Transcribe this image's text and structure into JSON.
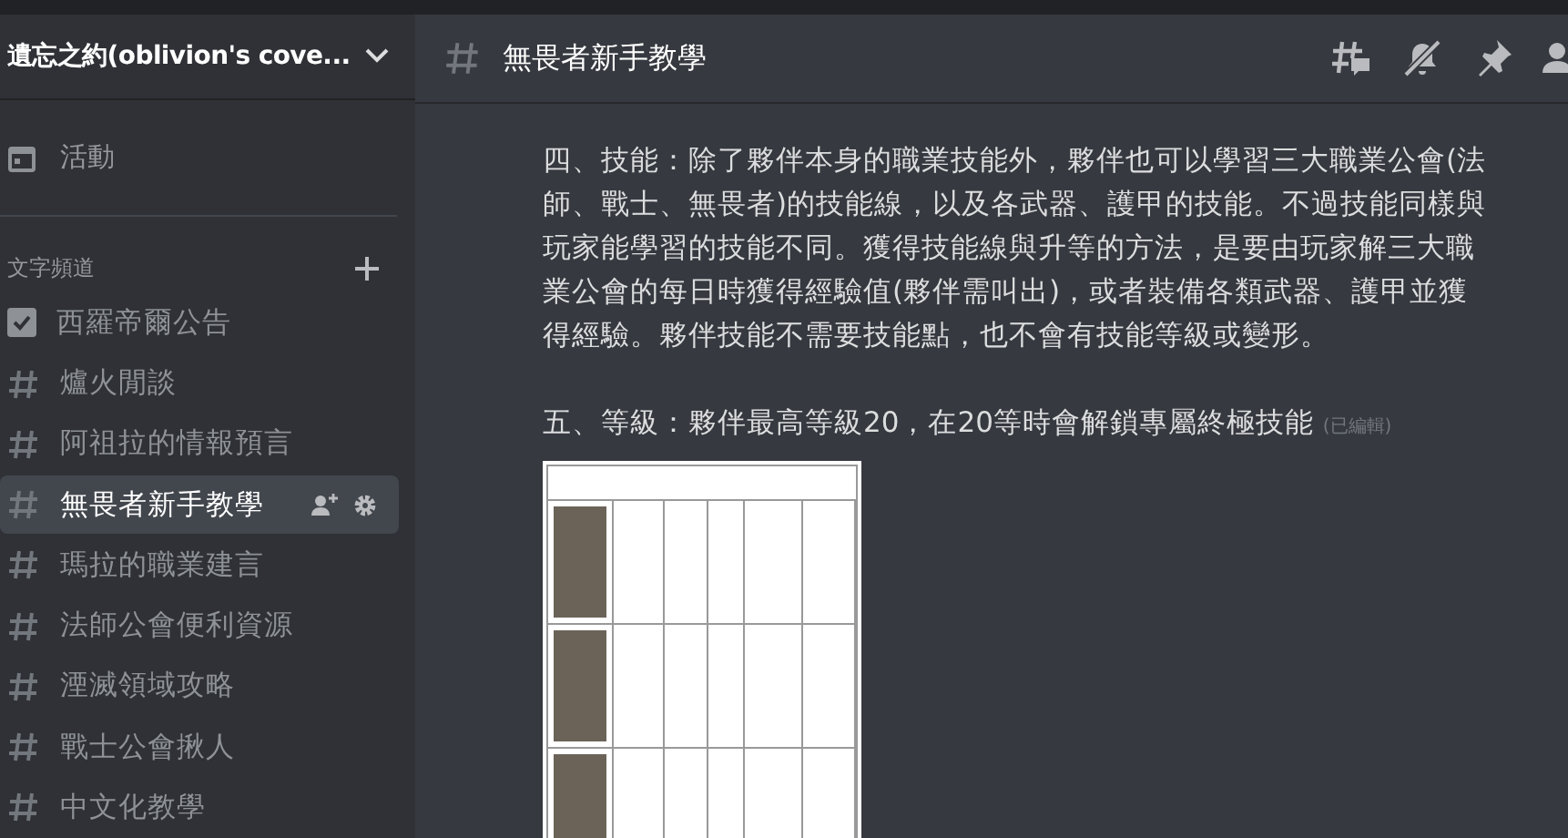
{
  "server": {
    "name": "遺忘之約(oblivion's cove..."
  },
  "sidebar": {
    "events_label": "活動",
    "category": "文字頻道",
    "channels": [
      {
        "name": "西羅帝爾公告",
        "kind": "announcement",
        "selected": false
      },
      {
        "name": "爐火閒談",
        "kind": "text",
        "selected": false
      },
      {
        "name": "阿祖拉的情報預言",
        "kind": "text",
        "selected": false
      },
      {
        "name": "無畏者新手教學",
        "kind": "text",
        "selected": true
      },
      {
        "name": "瑪拉的職業建言",
        "kind": "text",
        "selected": false
      },
      {
        "name": "法師公會便利資源",
        "kind": "text",
        "selected": false
      },
      {
        "name": "湮滅領域攻略",
        "kind": "text",
        "selected": false
      },
      {
        "name": "戰士公會揪人",
        "kind": "text",
        "selected": false
      },
      {
        "name": "中文化教學",
        "kind": "text",
        "selected": false
      }
    ]
  },
  "channel_header": {
    "title": "無畏者新手教學"
  },
  "message": {
    "paragraphs": [
      "四、技能：除了夥伴本身的職業技能外，夥伴也可以學習三大職業公會(法師、戰士、無畏者)的技能線，以及各武器、護甲的技能。不過技能同樣與玩家能學習的技能不同。獲得技能線與升等的方法，是要由玩家解三大職業公會的每日時獲得經驗值(夥伴需叫出)，或者裝備各類武器、護甲並獲得經驗。夥伴技能不需要技能點，也不會有技能等級或變形。",
      "五、等級：夥伴最高等級20，在20等時會解鎖專屬終極技能"
    ],
    "edited_label": "(已編輯)"
  }
}
